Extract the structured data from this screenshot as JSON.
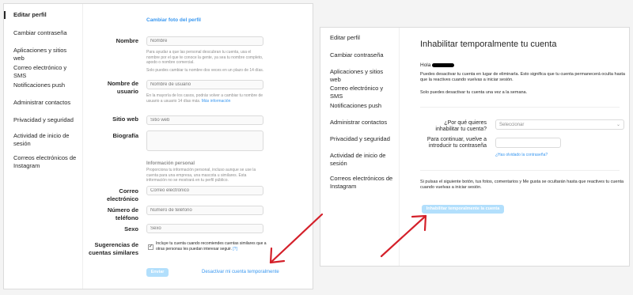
{
  "left": {
    "sidebar": {
      "items": [
        {
          "label": "Editar perfil"
        },
        {
          "label": "Cambiar contraseña"
        },
        {
          "label": "Aplicaciones y sitios web"
        },
        {
          "label": "Correo electrónico y SMS"
        },
        {
          "label": "Notificaciones push"
        },
        {
          "label": "Administrar contactos"
        },
        {
          "label": "Privacidad y seguridad"
        },
        {
          "label": "Actividad de inicio de sesión"
        },
        {
          "label": "Correos electrónicos de Instagram"
        }
      ]
    },
    "form": {
      "change_photo": "Cambiar foto del perfil",
      "name_label": "Nombre",
      "name_placeholder": "Nombre",
      "name_help": "Para ayudar a que las personal descubran tu cuenta, usa el nombre por el que te conoce la gente, ya sea tu nombre completo, apodo o nombre comercial.",
      "name_help2": "Solo puedes cambiar tu nombre dos veces en un plazo de 14 días.",
      "username_label": "Nombre de usuario",
      "username_placeholder": "Nombre de usuario",
      "username_help": "En la mayoría de los casos, podrás volver a cambiar tu nombre de usuario a usuario 14 días más.",
      "username_help_link": "Más información",
      "website_label": "Sitio web",
      "website_placeholder": "Sitio web",
      "bio_label": "Biografía",
      "personal_title": "Información personal",
      "personal_help": "Proporciona tu información personal, incluso aunque se use la cuenta para una empresa, una mascota u similares. Esta información no se mostrará en tu perfil público.",
      "email_label": "Correo electrónico",
      "email_placeholder": "Correo electrónico",
      "phone_label": "Número de teléfono",
      "phone_placeholder": "Número de teléfono",
      "sex_label": "Sexo",
      "sex_placeholder": "Sexo",
      "suggest_label": "Sugerencias de cuentas similares",
      "suggest_text": "Incluye tu cuenta cuando recomiendes cuentas similares que a otras personas les puedan interesar seguir.",
      "suggest_link": "[?]",
      "send_button": "Enviar",
      "deactivate_link": "Desactivar mi cuenta temporalmente"
    }
  },
  "right": {
    "sidebar": {
      "items": [
        {
          "label": "Editar perfil"
        },
        {
          "label": "Cambiar contraseña"
        },
        {
          "label": "Aplicaciones y sitios web"
        },
        {
          "label": "Correo electrónico y SMS"
        },
        {
          "label": "Notificaciones push"
        },
        {
          "label": "Administrar contactos"
        },
        {
          "label": "Privacidad y seguridad"
        },
        {
          "label": "Actividad de inicio de sesión"
        },
        {
          "label": "Correos electrónicos de Instagram"
        }
      ]
    },
    "content": {
      "title": "Inhabilitar temporalmente tu cuenta",
      "greeting": "Hola",
      "intro": "Puedes desactivar tu cuenta en lugar de eliminarla. Esto significa que tu cuenta permanecerá oculta hasta que la reactives cuando vuelvas a iniciar sesión.",
      "once_week": "Solo puedes desactivar tu cuenta una vez a la semana.",
      "reason_label": "¿Por qué quieres inhabilitar tu cuenta?",
      "reason_value": "Seleccionar",
      "password_label": "Para continuar, vuelve a introducir tu contraseña",
      "forgot_link": "¿Has olvidado la contraseña?",
      "notice": "Si pulsas el siguiente botón, tus fotos, comentarios y Me gusta se ocultarán hasta que reactives tu cuenta cuando vuelvas a iniciar sesión.",
      "disable_button": "Inhabilitar temporalmente la cuenta"
    }
  },
  "colors": {
    "arrow": "#d4202a",
    "link": "#3897f0",
    "button_disabled": "#b2dffc"
  }
}
